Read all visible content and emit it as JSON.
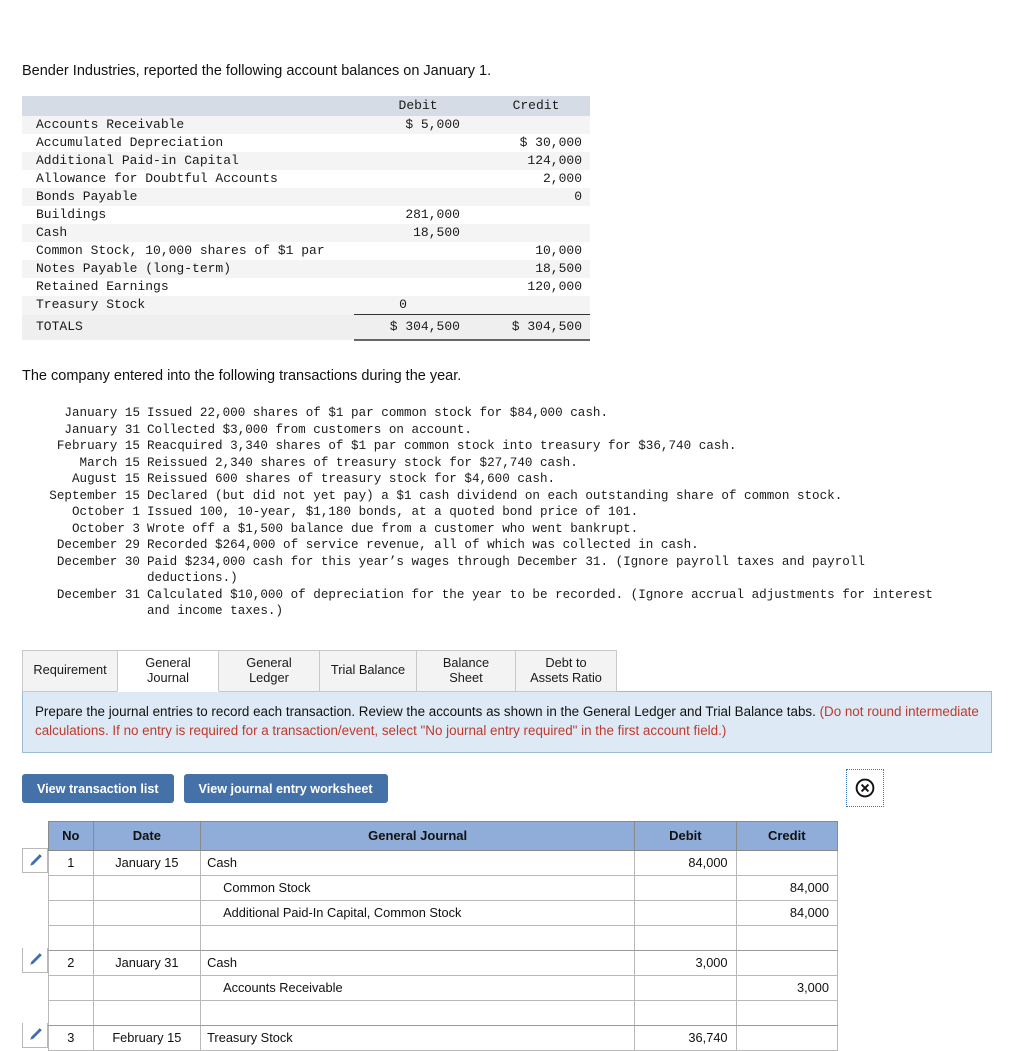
{
  "intro": {
    "line1": "Bender Industries, reported the following account balances on January 1.",
    "line2": "The company entered into the following transactions during the year."
  },
  "balance_table": {
    "headers": [
      "",
      "Debit",
      "Credit"
    ],
    "rows": [
      {
        "account": "Accounts Receivable",
        "debit": "$ 5,000",
        "credit": ""
      },
      {
        "account": "Accumulated Depreciation",
        "debit": "",
        "credit": "$ 30,000"
      },
      {
        "account": "Additional Paid-in Capital",
        "debit": "",
        "credit": "124,000"
      },
      {
        "account": "Allowance for Doubtful Accounts",
        "debit": "",
        "credit": "2,000"
      },
      {
        "account": "Bonds Payable",
        "debit": "",
        "credit": "0"
      },
      {
        "account": "Buildings",
        "debit": "281,000",
        "credit": ""
      },
      {
        "account": "Cash",
        "debit": "18,500",
        "credit": ""
      },
      {
        "account": "Common Stock, 10,000 shares of $1 par",
        "debit": "",
        "credit": "10,000"
      },
      {
        "account": "Notes Payable (long-term)",
        "debit": "",
        "credit": "18,500"
      },
      {
        "account": "Retained Earnings",
        "debit": "",
        "credit": "120,000"
      },
      {
        "account": "Treasury Stock",
        "debit": "0",
        "credit": ""
      }
    ],
    "totals": {
      "label": "TOTALS",
      "debit": "$ 304,500",
      "credit": "$ 304,500"
    }
  },
  "transactions": [
    {
      "date": "January 15",
      "text": "Issued 22,000 shares of $1 par common stock for $84,000 cash."
    },
    {
      "date": "January 31",
      "text": "Collected $3,000 from customers on account."
    },
    {
      "date": "February 15",
      "text": "Reacquired 3,340 shares of $1 par common stock into treasury for $36,740 cash."
    },
    {
      "date": "March 15",
      "text": "Reissued 2,340 shares of treasury stock for $27,740 cash."
    },
    {
      "date": "August 15",
      "text": "Reissued 600 shares of treasury stock for $4,600 cash."
    },
    {
      "date": "September 15",
      "text": "Declared (but did not yet pay) a $1 cash dividend on each outstanding share of common stock."
    },
    {
      "date": "October 1",
      "text": "Issued 100, 10-year, $1,180 bonds, at a quoted bond price of 101."
    },
    {
      "date": "October 3",
      "text": "Wrote off a $1,500 balance due from a customer who went bankrupt."
    },
    {
      "date": "December 29",
      "text": "Recorded $264,000 of service revenue, all of which was collected in cash."
    },
    {
      "date": "December 30",
      "text": "Paid $234,000 cash for this year’s wages through December 31. (Ignore payroll taxes and payroll",
      "cont": "deductions.)"
    },
    {
      "date": "December 31",
      "text": "Calculated $10,000 of depreciation for the year to be recorded. (Ignore accrual adjustments for interest",
      "cont": "and income taxes.)"
    }
  ],
  "tabs": [
    {
      "label": "Requirement",
      "active": false
    },
    {
      "label": "General Journal",
      "active": true
    },
    {
      "label": "General Ledger",
      "active": false
    },
    {
      "label": "Trial Balance",
      "active": false
    },
    {
      "label": "Balance Sheet",
      "active": false
    },
    {
      "label": "Debt to Assets Ratio",
      "active": false
    }
  ],
  "instruction": {
    "black": "Prepare the journal entries to record each transaction. Review the accounts as shown in the General Ledger and Trial Balance tabs. ",
    "red": "(Do not round intermediate calculations. If no entry is required for a transaction/event, select \"No journal entry required\" in the first account field.)"
  },
  "actions": {
    "view_transaction_list": "View transaction list",
    "view_worksheet": "View journal entry worksheet",
    "close_icon": "circle-x-icon"
  },
  "journal": {
    "headers": [
      "No",
      "Date",
      "General Journal",
      "Debit",
      "Credit"
    ],
    "rows": [
      {
        "edit": true,
        "no": "1",
        "date": "January 15",
        "account": "Cash",
        "indent": false,
        "debit": "84,000",
        "credit": "",
        "spacer": false
      },
      {
        "edit": false,
        "no": "",
        "date": "",
        "account": "Common Stock",
        "indent": true,
        "debit": "",
        "credit": "84,000",
        "spacer": false
      },
      {
        "edit": false,
        "no": "",
        "date": "",
        "account": "Additional Paid-In Capital, Common Stock",
        "indent": true,
        "debit": "",
        "credit": "84,000",
        "spacer": false
      },
      {
        "edit": false,
        "no": "",
        "date": "",
        "account": "",
        "indent": false,
        "debit": "",
        "credit": "",
        "spacer": true
      },
      {
        "edit": true,
        "no": "2",
        "date": "January 31",
        "account": "Cash",
        "indent": false,
        "debit": "3,000",
        "credit": "",
        "spacer": false
      },
      {
        "edit": false,
        "no": "",
        "date": "",
        "account": "Accounts Receivable",
        "indent": true,
        "debit": "",
        "credit": "3,000",
        "spacer": false
      },
      {
        "edit": false,
        "no": "",
        "date": "",
        "account": "",
        "indent": false,
        "debit": "",
        "credit": "",
        "spacer": true
      },
      {
        "edit": true,
        "no": "3",
        "date": "February 15",
        "account": "Treasury Stock",
        "indent": false,
        "debit": "36,740",
        "credit": "",
        "spacer": false
      }
    ],
    "edit_icon": "pencil-icon"
  },
  "colors": {
    "journal_header_blue": "#8FADD8",
    "button_blue": "#4472A8",
    "instruction_bg": "#DDEAF6",
    "instruction_border": "#9DBBD6",
    "red_text": "#C0392B",
    "balance_header_gray": "#D6DCE5"
  }
}
